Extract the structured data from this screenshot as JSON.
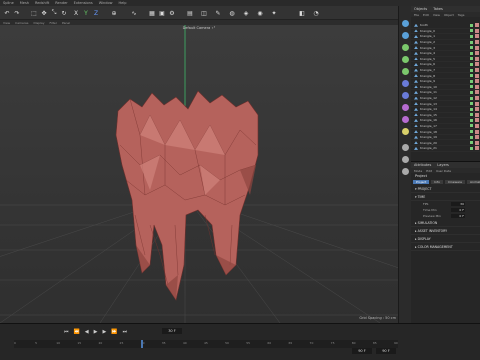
{
  "menubar": [
    "Spline",
    "Mesh",
    "Redshift",
    "Render",
    "Extensions",
    "Window",
    "Help"
  ],
  "viewport_menu": [
    "View",
    "Cameras",
    "Display",
    "Filter",
    "Panel"
  ],
  "viewport": {
    "camera_label": "Default Camera ∘°",
    "grid_spacing": "Grid Spacing : 50 cm"
  },
  "object_panel": {
    "tabs": [
      "Objects",
      "Takes"
    ],
    "menu": [
      "File",
      "Edit",
      "View",
      "Object",
      "Tags"
    ],
    "items": [
      "tooth",
      "triangle_0",
      "triangle_1",
      "triangle_2",
      "triangle_3",
      "triangle_4",
      "triangle_5",
      "triangle_6",
      "triangle_7",
      "triangle_8",
      "triangle_9",
      "triangle_10",
      "triangle_11",
      "triangle_12",
      "triangle_13",
      "triangle_14",
      "triangle_15",
      "triangle_16",
      "triangle_17",
      "triangle_18",
      "triangle_19",
      "triangle_20",
      "triangle_21"
    ]
  },
  "attributes": {
    "tabs": [
      "Attributes",
      "Layers"
    ],
    "menu": [
      "Mode",
      "Edit",
      "User Data"
    ],
    "title": "Project",
    "subtabs": [
      "Project",
      "Info",
      "Cineware",
      "Animation"
    ],
    "sections": [
      "PROJECT",
      "TIME",
      "SIMULATION",
      "ASSET INVENTORY",
      "DISPLAY",
      "COLOR MANAGEMENT"
    ],
    "fields": [
      {
        "label": "FPS",
        "value": "30"
      },
      {
        "label": "Time Min",
        "value": "0 F"
      },
      {
        "label": "Preview Min",
        "value": "0 F"
      }
    ]
  },
  "timeline": {
    "current_frame": "30 F",
    "end_frame": "90 F",
    "end_frame2": "90 F",
    "ticks": [
      "0",
      "5",
      "10",
      "15",
      "20",
      "25",
      "30",
      "35",
      "40",
      "45",
      "50",
      "55",
      "60",
      "65",
      "70",
      "75",
      "80",
      "85",
      "90"
    ]
  }
}
